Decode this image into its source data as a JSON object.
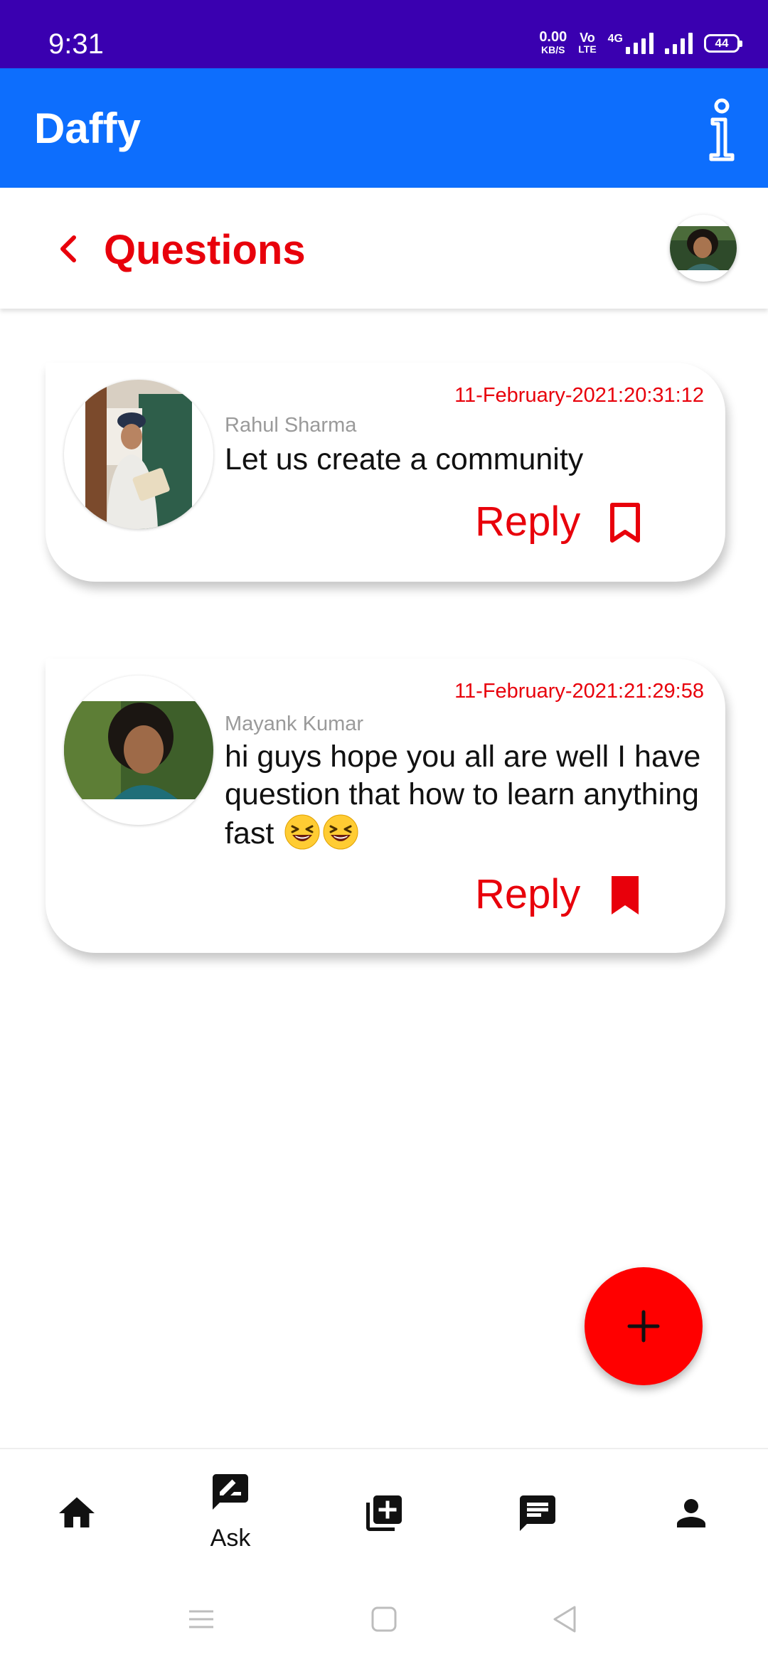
{
  "status_bar": {
    "time": "9:31",
    "speed_value": "0.00",
    "speed_unit": "KB/S",
    "volte_top": "Vo",
    "volte_bottom": "LTE",
    "network": "4G",
    "battery": "44"
  },
  "app_bar": {
    "title": "Daffy",
    "info_icon": "info-icon"
  },
  "header": {
    "title": "Questions",
    "back_icon": "chevron-left-icon"
  },
  "questions": [
    {
      "author": "Rahul Sharma",
      "timestamp": "11-February-2021:20:31:12",
      "text": "Let us create a community",
      "reply_label": "Reply",
      "bookmarked": false
    },
    {
      "author": "Mayank Kumar",
      "timestamp": "11-February-2021:21:29:58",
      "text": "hi guys hope you all are well I have question that how to learn anything fast",
      "emoji": "laughing-face-emoji",
      "reply_label": "Reply",
      "bookmarked": true
    }
  ],
  "fab": {
    "icon": "plus-icon"
  },
  "bottom_nav": {
    "items": [
      {
        "icon": "home-icon",
        "label": ""
      },
      {
        "icon": "edit-chat-icon",
        "label": "Ask"
      },
      {
        "icon": "add-library-icon",
        "label": ""
      },
      {
        "icon": "message-icon",
        "label": ""
      },
      {
        "icon": "person-icon",
        "label": ""
      }
    ]
  },
  "colors": {
    "status_bar": "#3a00b0",
    "app_bar": "#0d6efd",
    "accent_red": "#e8000b",
    "fab": "#ff0000"
  }
}
